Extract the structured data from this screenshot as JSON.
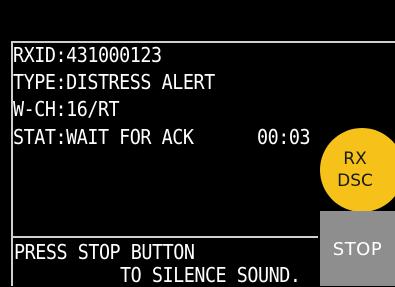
{
  "info": {
    "rxid": "RXID:431000123",
    "type": "TYPE:DISTRESS ALERT",
    "wch": "W-CH:16/RT",
    "stat": "STAT:WAIT FOR ACK",
    "timer": "00:03"
  },
  "badge": {
    "line1": "RX",
    "line2": "DSC",
    "color": "#f6c21a"
  },
  "stop_button": {
    "label": "STOP",
    "color": "#8e8e8e"
  },
  "message": {
    "line1": "PRESS STOP BUTTON",
    "line2": "TO SILENCE SOUND."
  }
}
